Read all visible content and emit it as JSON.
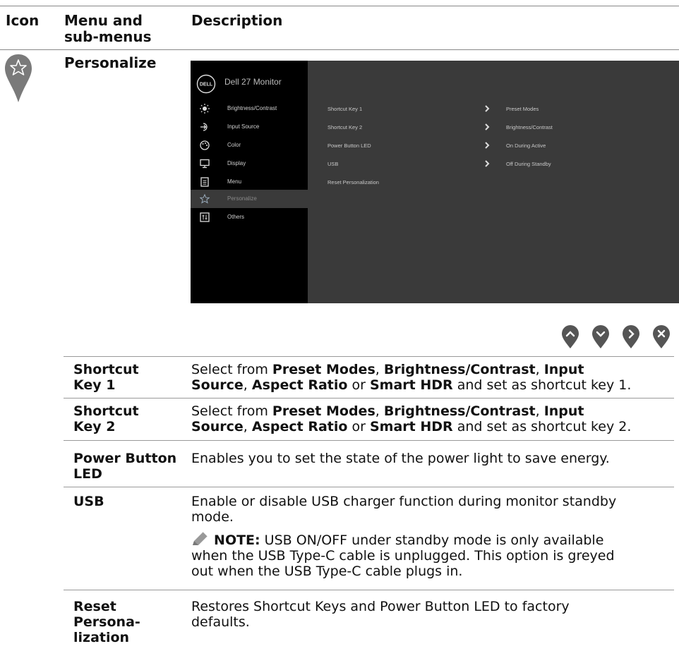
{
  "header": {
    "col_icon": "Icon",
    "col_menu_line1": "Menu and",
    "col_menu_line2": "sub-menus",
    "col_desc": "Description"
  },
  "section": {
    "title": "Personalize",
    "icon": "star-pin-icon"
  },
  "osd": {
    "brand": "DELL",
    "model": "Dell 27 Monitor",
    "menu": [
      {
        "label": "Brightness/Contrast",
        "icon": "sun-icon"
      },
      {
        "label": "Input Source",
        "icon": "input-icon"
      },
      {
        "label": "Color",
        "icon": "palette-icon"
      },
      {
        "label": "Display",
        "icon": "monitor-icon"
      },
      {
        "label": "Menu",
        "icon": "menu-icon"
      },
      {
        "label": "Personalize",
        "icon": "star-icon",
        "active": true
      },
      {
        "label": "Others",
        "icon": "others-icon"
      }
    ],
    "rows": [
      {
        "label": "Shortcut Key 1",
        "value": "Preset Modes"
      },
      {
        "label": "Shortcut Key 2",
        "value": "Brightness/Contrast"
      },
      {
        "label": "Power Button LED",
        "value": "On During Active"
      },
      {
        "label": "USB",
        "value": "Off During Standby"
      },
      {
        "label": "Reset Personalization",
        "value": ""
      }
    ]
  },
  "nav_buttons": [
    "up-icon",
    "down-icon",
    "right-icon",
    "close-icon"
  ],
  "table": [
    {
      "label_line1": "Shortcut",
      "label_line2": "Key 1",
      "desc_line1": [
        {
          "t": "Select from "
        },
        {
          "b": "Preset Modes"
        },
        {
          "t": ", "
        },
        {
          "b": "Brightness/Contrast"
        },
        {
          "t": ", "
        },
        {
          "b": "Input"
        }
      ],
      "desc_line2": [
        {
          "b": "Source"
        },
        {
          "t": ", "
        },
        {
          "b": "Aspect Ratio"
        },
        {
          "t": " or "
        },
        {
          "b": "Smart HDR"
        },
        {
          "t": " and set as shortcut key 1."
        }
      ]
    },
    {
      "label_line1": "Shortcut",
      "label_line2": "Key 2",
      "desc_line1": [
        {
          "t": "Select from "
        },
        {
          "b": "Preset Modes"
        },
        {
          "t": ", "
        },
        {
          "b": "Brightness/Contrast"
        },
        {
          "t": ", "
        },
        {
          "b": "Input"
        }
      ],
      "desc_line2": [
        {
          "b": "Source"
        },
        {
          "t": ", "
        },
        {
          "b": "Aspect Ratio"
        },
        {
          "t": " or "
        },
        {
          "b": "Smart HDR"
        },
        {
          "t": " and set as shortcut key 2."
        }
      ]
    },
    {
      "label_line1": "Power Button",
      "label_line2": "LED",
      "desc": "Enables you to set the state of the power light to save energy."
    },
    {
      "label_line1": "USB",
      "desc_line1": "Enable or disable USB charger function during monitor standby",
      "desc_line2": "mode.",
      "note_label": "NOTE:",
      "note_line1": " USB ON/OFF under standby mode is only available",
      "note_line2": "when the USB Type-C cable is unplugged. This option is greyed",
      "note_line3": "out when the USB Type-C cable plugs in."
    },
    {
      "label_line1": "Reset",
      "label_line2": "Persona-",
      "label_line3": "lization",
      "desc_line1": "Restores Shortcut Keys and Power Button LED to factory",
      "desc_line2": "defaults."
    }
  ]
}
